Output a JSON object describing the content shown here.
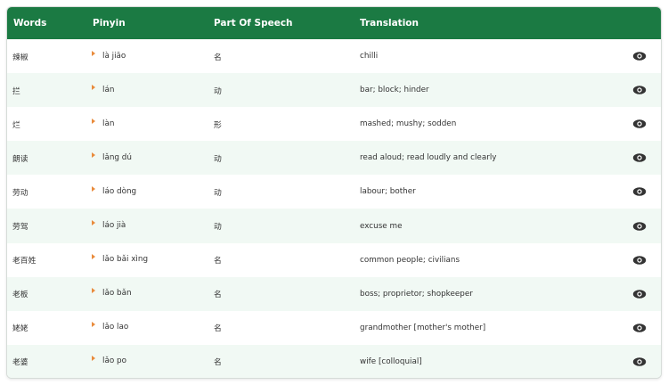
{
  "table": {
    "headers": {
      "words": "Words",
      "pinyin": "Pinyin",
      "part_of_speech": "Part Of Speech",
      "translation": "Translation"
    },
    "rows": [
      {
        "word": "辣椒",
        "pinyin": "là jiāo",
        "pos": "名",
        "translation": "chilli"
      },
      {
        "word": "拦",
        "pinyin": "lán",
        "pos": "动",
        "translation": "bar; block; hinder"
      },
      {
        "word": "烂",
        "pinyin": "làn",
        "pos": "形",
        "translation": "mashed; mushy; sodden"
      },
      {
        "word": "朗读",
        "pinyin": "lǎng dú",
        "pos": "动",
        "translation": "read aloud; read loudly and clearly"
      },
      {
        "word": "劳动",
        "pinyin": "láo dòng",
        "pos": "动",
        "translation": "labour; bother"
      },
      {
        "word": "劳驾",
        "pinyin": "láo jià",
        "pos": "动",
        "translation": "excuse me"
      },
      {
        "word": "老百姓",
        "pinyin": "lǎo bǎi xìng",
        "pos": "名",
        "translation": "common people; civilians"
      },
      {
        "word": "老板",
        "pinyin": "lǎo bǎn",
        "pos": "名",
        "translation": "boss; proprietor; shopkeeper"
      },
      {
        "word": "姥姥",
        "pinyin": "lǎo lao",
        "pos": "名",
        "translation": "grandmother [mother's mother]"
      },
      {
        "word": "老婆",
        "pinyin": "lǎo po",
        "pos": "名",
        "translation": "wife [colloquial]"
      }
    ]
  },
  "colors": {
    "header_bg": "#1b7a43",
    "header_text": "#ffffff",
    "row_alt_bg": "#f1f9f4",
    "play_icon": "#e98b3c",
    "eye_icon": "#333333"
  },
  "icons": {
    "play": "play-audio-icon",
    "reveal": "eye-icon"
  }
}
